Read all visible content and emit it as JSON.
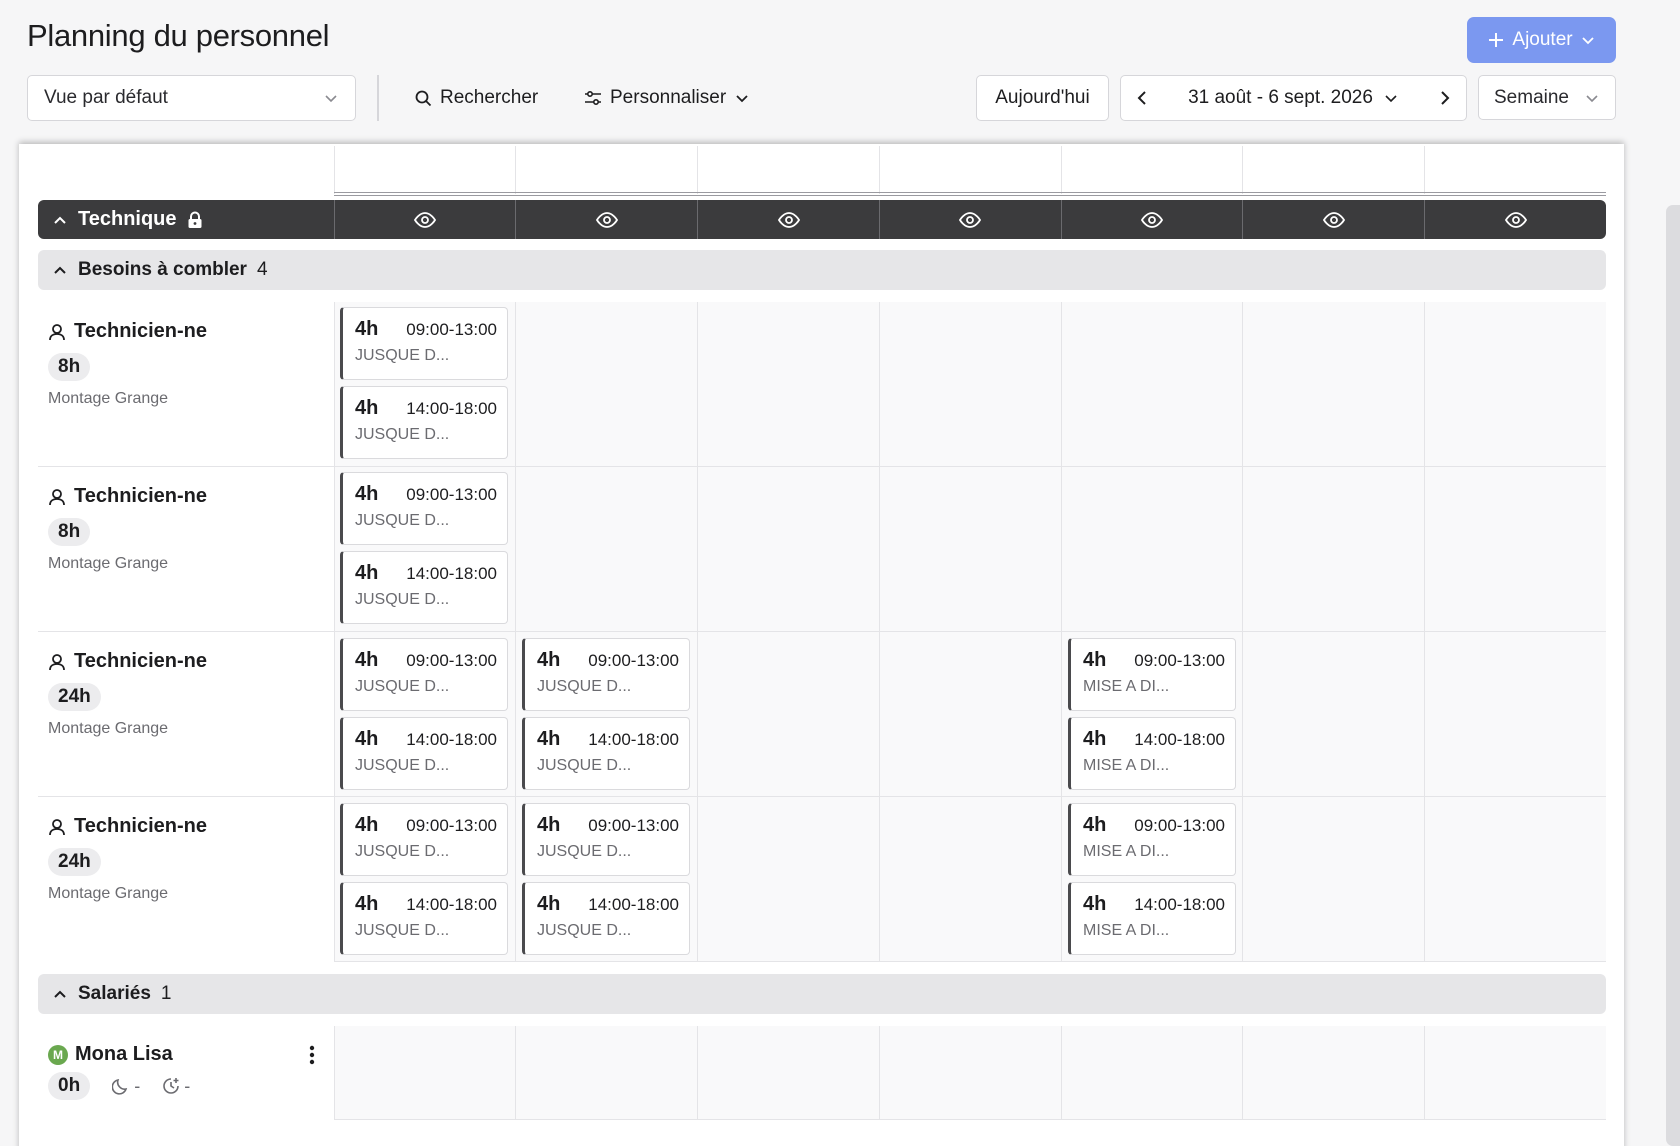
{
  "header": {
    "title": "Planning du personnel",
    "add_label": "Ajouter"
  },
  "toolbar": {
    "view_value": "Vue par défaut",
    "search_label": "Rechercher",
    "customize_label": "Personnaliser",
    "today_label": "Aujourd'hui",
    "date_range": "31 août - 6 sept. 2026",
    "period_value": "Semaine"
  },
  "group": {
    "name": "Technique"
  },
  "sections": {
    "needs": {
      "name": "Besoins à combler",
      "count": "4"
    },
    "employees": {
      "name": "Salariés",
      "count": "1"
    }
  },
  "needs": [
    {
      "role": "Technicien-ne",
      "hours": "8h",
      "location": "Montage Grange"
    },
    {
      "role": "Technicien-ne",
      "hours": "8h",
      "location": "Montage Grange"
    },
    {
      "role": "Technicien-ne",
      "hours": "24h",
      "location": "Montage Grange"
    },
    {
      "role": "Technicien-ne",
      "hours": "24h",
      "location": "Montage Grange"
    }
  ],
  "shifts": {
    "s1": {
      "duration": "4h",
      "time": "09:00-13:00",
      "label": "JUSQUE D..."
    },
    "s2": {
      "duration": "4h",
      "time": "14:00-18:00",
      "label": "JUSQUE D..."
    },
    "s3": {
      "duration": "4h",
      "time": "09:00-13:00",
      "label": "MISE A DI..."
    },
    "s4": {
      "duration": "4h",
      "time": "14:00-18:00",
      "label": "MISE A DI..."
    }
  },
  "employees": [
    {
      "initial": "M",
      "name": "Mona Lisa",
      "hours": "0h",
      "night": "-",
      "overtime": "-"
    }
  ]
}
